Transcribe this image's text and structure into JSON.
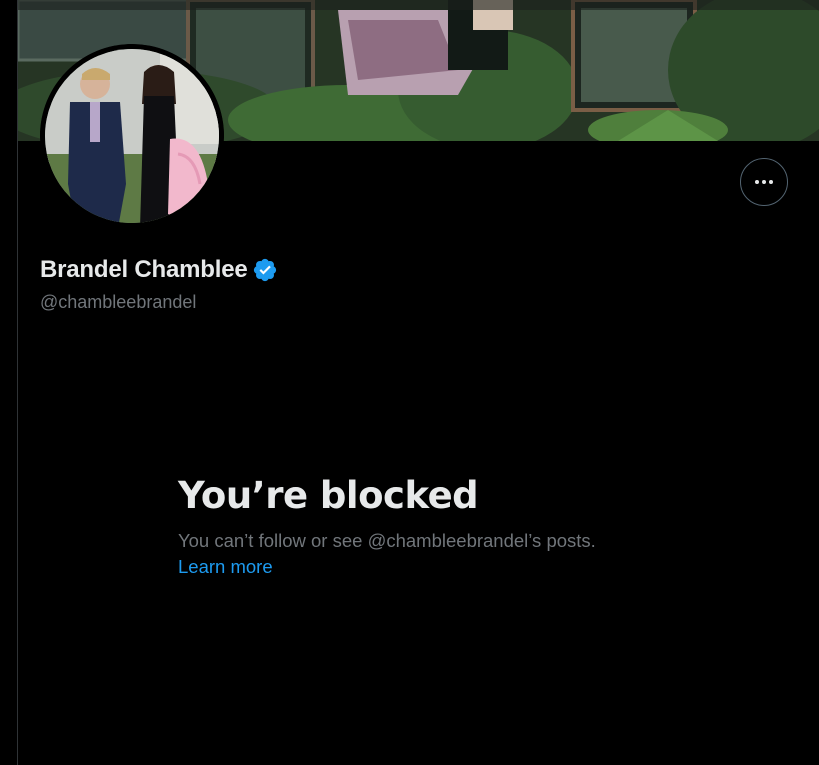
{
  "profile": {
    "display_name": "Brandel Chamblee",
    "handle": "@chambleebrandel",
    "verified": true
  },
  "blocked_notice": {
    "title": "You’re blocked",
    "description": "You can’t follow or see @chambleebrandel’s posts.",
    "learn_more_label": "Learn more"
  },
  "icons": {
    "more": "more-horizontal-icon",
    "verified": "verified-badge-icon"
  },
  "colors": {
    "background": "#000000",
    "primary_text": "#e7e9ea",
    "secondary_text": "#71767b",
    "accent": "#1d9bf0",
    "border": "#2f3336"
  }
}
